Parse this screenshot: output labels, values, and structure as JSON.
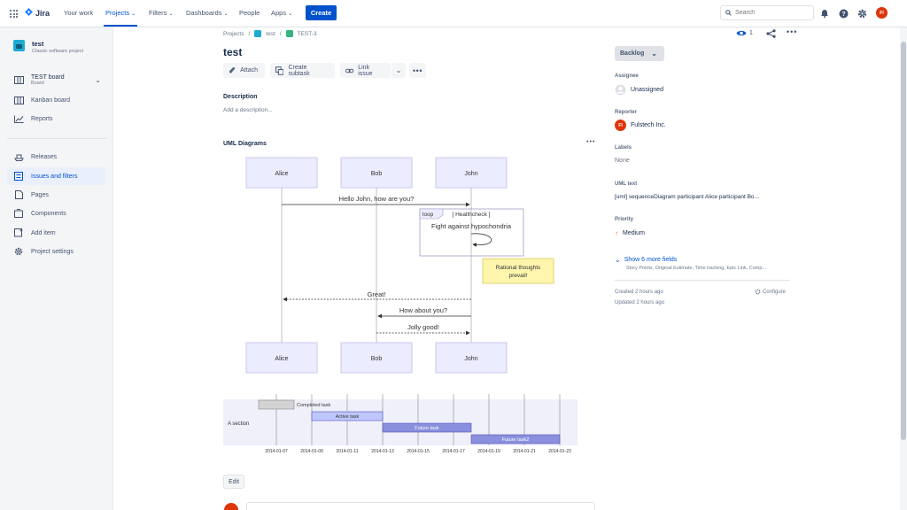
{
  "nav": {
    "logo": "Jira",
    "items": [
      {
        "label": "Your work"
      },
      {
        "label": "Projects"
      },
      {
        "label": "Filters"
      },
      {
        "label": "Dashboards"
      },
      {
        "label": "People"
      },
      {
        "label": "Apps"
      }
    ],
    "create": "Create",
    "search_placeholder": "Search",
    "avatar_initials": "FI"
  },
  "sidebar": {
    "project_name": "test",
    "project_type": "Classic software project",
    "board_name": "TEST board",
    "board_sub": "Board",
    "items": [
      {
        "label": "Kanban board"
      },
      {
        "label": "Reports"
      },
      {
        "label": "Releases"
      },
      {
        "label": "Issues and filters"
      },
      {
        "label": "Pages"
      },
      {
        "label": "Components"
      },
      {
        "label": "Add item"
      },
      {
        "label": "Project settings"
      }
    ]
  },
  "breadcrumb": {
    "projects": "Projects",
    "project": "test",
    "issue": "TEST-3"
  },
  "issue": {
    "title": "test",
    "actions": {
      "attach": "Attach",
      "subtask": "Create subtask",
      "link": "Link issue"
    },
    "description_label": "Description",
    "description_placeholder": "Add a description...",
    "uml_label": "UML Diagrams",
    "edit": "Edit",
    "watchers": "1"
  },
  "sequence": {
    "participants": [
      "Alice",
      "Bob",
      "John"
    ],
    "messages": [
      {
        "text": "Hello John, how are you?"
      },
      {
        "text": "Great!"
      },
      {
        "text": "How about you?"
      },
      {
        "text": "Jolly good!"
      }
    ],
    "loop_tag": "loop",
    "loop_label": "[ Healthcheck ]",
    "loop_message": "Fight against hypochondria",
    "note_line1": "Rational thoughts",
    "note_line2": "prevail!"
  },
  "gantt": {
    "section": "A section",
    "tasks": [
      {
        "name": "Completed task"
      },
      {
        "name": "Active task"
      },
      {
        "name": "Future task"
      },
      {
        "name": "Future task2"
      }
    ],
    "ticks": [
      "2014-01-07",
      "2014-01-09",
      "2014-01-11",
      "2014-01-13",
      "2014-01-15",
      "2014-01-17",
      "2014-01-19",
      "2014-01-21",
      "2014-01-23"
    ]
  },
  "details": {
    "status": "Backlog",
    "assignee_label": "Assignee",
    "assignee": "Unassigned",
    "reporter_label": "Reporter",
    "reporter": "Fulstech Inc.",
    "reporter_initials": "FI",
    "labels_label": "Labels",
    "labels": "None",
    "uml_text_label": "UML text",
    "uml_text": "[uml] sequenceDiagram participant Alice participant Bo...",
    "priority_label": "Priority",
    "priority": "Medium",
    "more_fields": "Show 6 more fields",
    "more_fields_sub": "Story Points, Original Estimate, Time tracking, Epic Link, Comp...",
    "created": "Created 2 hours ago",
    "updated": "Updated 2 hours ago",
    "configure": "Configure"
  },
  "colors": {
    "accent": "#0052cc",
    "participant_fill": "#ececff",
    "participant_stroke": "#9370db",
    "note_fill": "#fff5ad",
    "bar_active": "#bfc7ff",
    "bar_future": "#8a90dd",
    "bar_done": "#d3d3d3"
  }
}
